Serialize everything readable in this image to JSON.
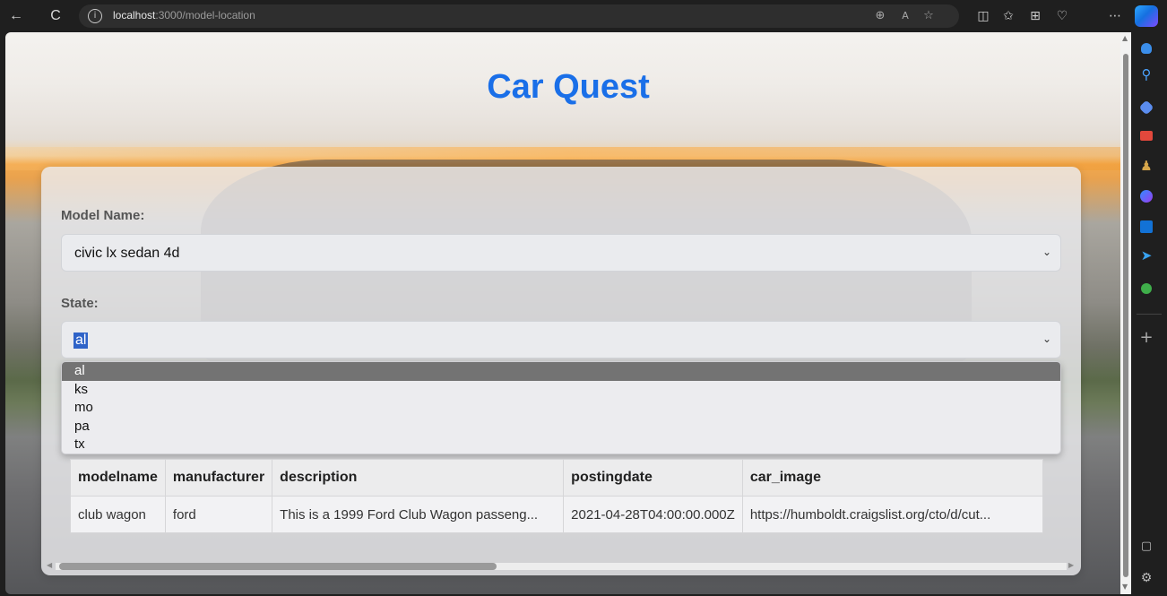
{
  "browser": {
    "url_host": "localhost",
    "url_path": ":3000/model-location"
  },
  "page": {
    "title": "Car Quest"
  },
  "form": {
    "model_label": "Model Name:",
    "model_value": "civic lx sedan 4d",
    "state_label": "State:",
    "state_value": "al",
    "state_options": [
      "al",
      "ks",
      "mo",
      "pa",
      "tx"
    ],
    "state_selected": "al"
  },
  "table": {
    "headers": [
      "modelname",
      "manufacturer",
      "description",
      "postingdate",
      "car_image"
    ],
    "rows": [
      [
        "club wagon",
        "ford",
        "This is a 1999 Ford Club Wagon passeng...",
        "2021-04-28T04:00:00.000Z",
        "https://humboldt.craigslist.org/cto/d/cut..."
      ]
    ]
  },
  "colors": {
    "title": "#1a6fe8",
    "selection_highlight": "#2f63c8",
    "dropdown_selected": "#737373"
  }
}
